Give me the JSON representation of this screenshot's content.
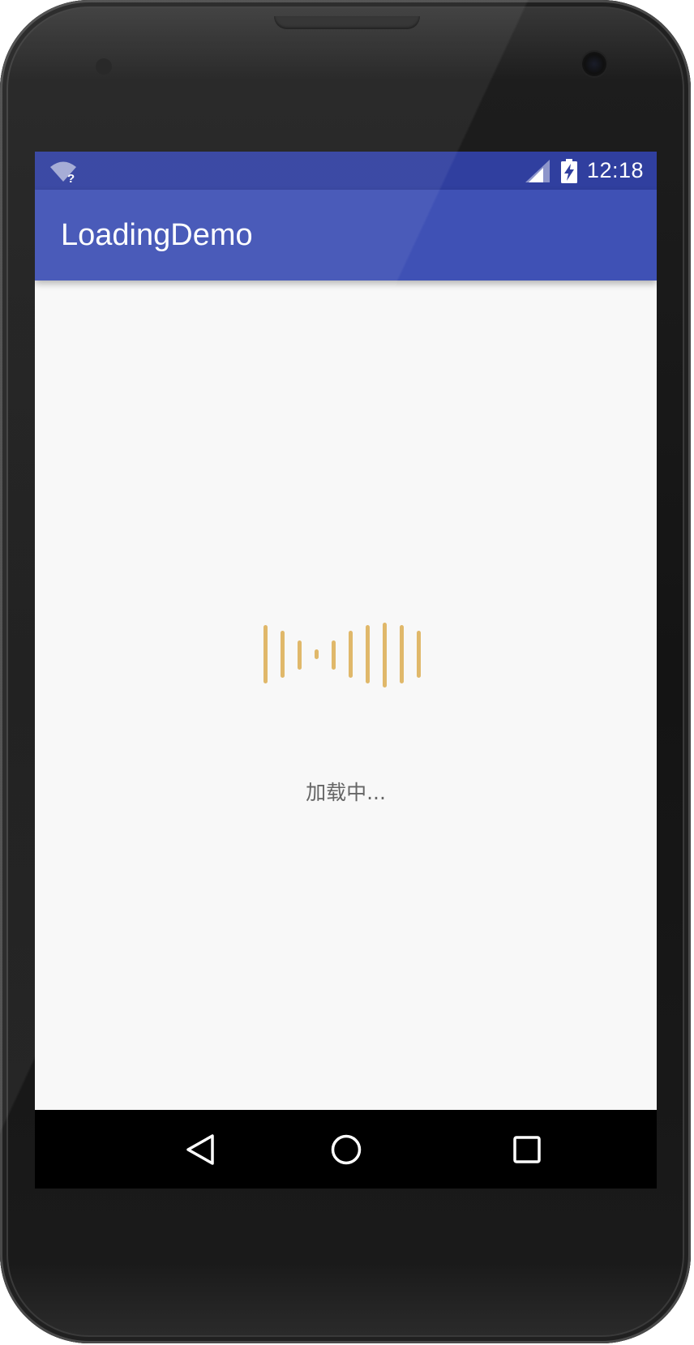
{
  "status_bar": {
    "time": "12:18",
    "wifi_badge": "?",
    "icons": [
      "wifi-unknown-icon",
      "cell-signal-icon",
      "battery-charging-icon"
    ],
    "background": "#303f9f"
  },
  "toolbar": {
    "title": "LoadingDemo",
    "background": "#3f51b5"
  },
  "main": {
    "loading_text": "加载中...",
    "loader_bar_count": 10,
    "loader_color": "#e0b86a",
    "background": "#f8f8f8"
  },
  "nav_bar": {
    "buttons": [
      "back-icon",
      "home-icon",
      "recents-icon"
    ],
    "background": "#000000"
  }
}
